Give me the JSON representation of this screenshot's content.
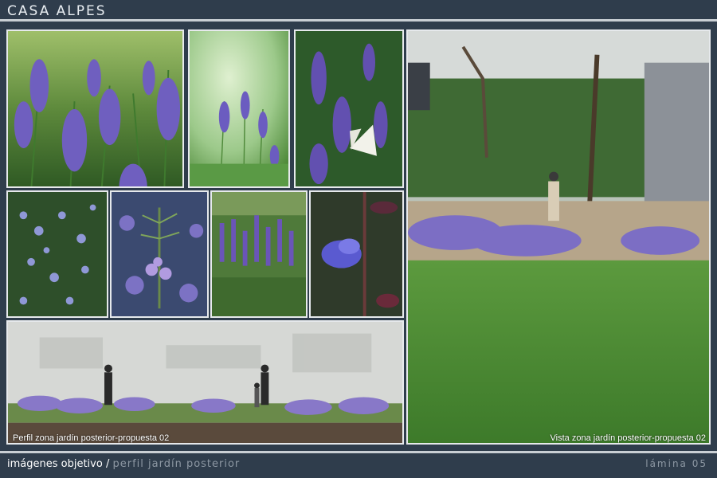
{
  "header": {
    "title": "CASA ALPES"
  },
  "photos": {
    "lavender_field": "lavender field photo",
    "lavender_single": "lavender stems photo",
    "lavender_butterfly": "lavender with white butterfly photo",
    "rosemary_shrub": "flowering rosemary shrub photo",
    "rosemary_flower": "rosemary sprig with flowers photo",
    "salvia_field": "purple salvia planting photo",
    "salvia_flower": "salvia flower close-up photo"
  },
  "profile": {
    "caption": "Perfil zona jardín posterior-propuesta 02"
  },
  "garden_view": {
    "caption": "Vista zona jardín posterior-propuesta 02"
  },
  "footer": {
    "section": "imágenes objetivo",
    "separator": "/",
    "subsection": "perfil jardín posterior",
    "sheet": "lámina 05"
  },
  "colors": {
    "background": "#2f3d4c",
    "lavender": "#7a6bc0",
    "grass": "#4e8a3a"
  }
}
